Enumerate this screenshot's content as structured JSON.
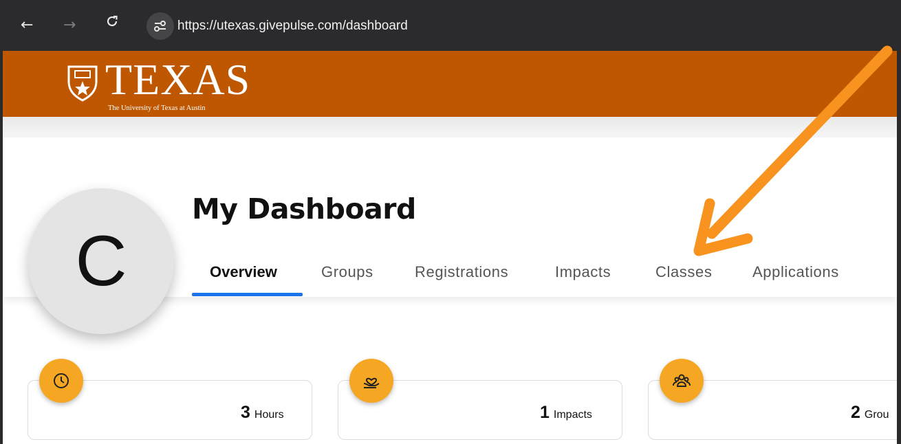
{
  "browser": {
    "back_icon": "arrow-left-icon",
    "forward_icon": "arrow-right-icon",
    "reload_icon": "reload-icon",
    "site_info_icon": "tune-icon",
    "url": "https://utexas.givepulse.com/dashboard"
  },
  "brand": {
    "wordmark": "TEXAS",
    "subtitle": "The University of Texas at Austin",
    "color": "#bf5700"
  },
  "profile": {
    "initial": "C"
  },
  "page": {
    "title": "My Dashboard"
  },
  "tabs": [
    {
      "label": "Overview",
      "active": true
    },
    {
      "label": "Groups"
    },
    {
      "label": "Registrations"
    },
    {
      "label": "Impacts"
    },
    {
      "label": "Classes"
    },
    {
      "label": "Applications"
    }
  ],
  "stats": [
    {
      "value": "3",
      "label": "Hours",
      "icon": "clock-icon"
    },
    {
      "value": "1",
      "label": "Impacts",
      "icon": "hand-heart-icon"
    },
    {
      "value": "2",
      "label": "Grou",
      "icon": "group-icon"
    }
  ],
  "annotation": {
    "arrow_color": "#f7931e"
  },
  "colors": {
    "accent": "#1a73e8",
    "badge": "#f5a623"
  }
}
